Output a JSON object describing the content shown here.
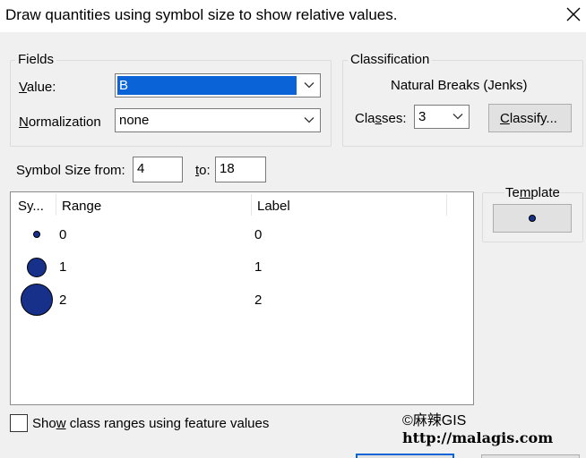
{
  "dialog": {
    "title": "Draw quantities using symbol size to show relative values."
  },
  "fields": {
    "group_label": "Fields",
    "value_label_u": "V",
    "value_label_rest": "alue:",
    "value_selected": "B",
    "normalization_label_u": "N",
    "normalization_label_rest": "ormalization",
    "normalization_selected": "none"
  },
  "classification": {
    "group_label": "Classification",
    "method": "Natural Breaks (Jenks)",
    "classes_label_a": "Cla",
    "classes_label_u": "s",
    "classes_label_b": "ses:",
    "classes_value": "3",
    "classify_u": "C",
    "classify_rest": "lassify..."
  },
  "symbol_size": {
    "from_label": "Symbol Size from:",
    "from_value": "4",
    "to_label_u": "t",
    "to_label_rest": "o:",
    "to_value": "18"
  },
  "template": {
    "label_a": "Te",
    "label_u": "m",
    "label_b": "plate"
  },
  "table": {
    "columns": [
      "Sy...",
      "Range",
      "Label"
    ],
    "rows": [
      {
        "range": "0",
        "label": "0"
      },
      {
        "range": "1",
        "label": "1"
      },
      {
        "range": "2",
        "label": "2"
      }
    ]
  },
  "footer": {
    "show_ranges_a": "Sho",
    "show_ranges_u": "w",
    "show_ranges_b": " class ranges using feature values",
    "show_ranges_checked": false
  },
  "watermark": {
    "line1": "©麻辣GIS",
    "line2": "http://malagis.com"
  },
  "colors": {
    "symbol_fill": "#17318a",
    "selection": "#0a64d8"
  }
}
